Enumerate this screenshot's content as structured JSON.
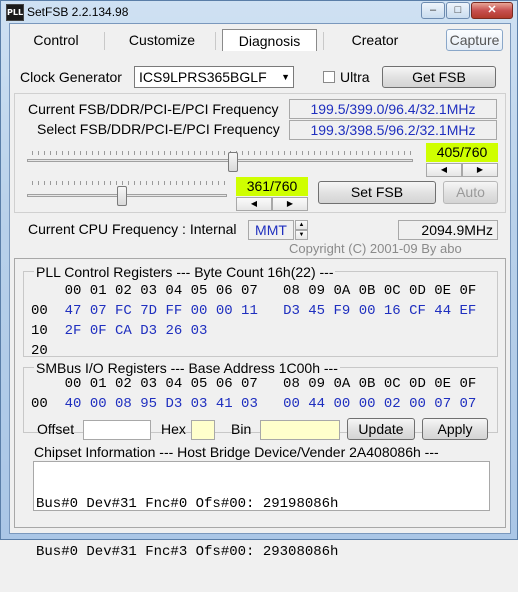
{
  "window": {
    "title": "SetFSB 2.2.134.98",
    "icon_text": "PLL",
    "controls": {
      "minimize": "–",
      "maximize": "□",
      "close": "✕"
    }
  },
  "tabs": [
    {
      "label": "Control"
    },
    {
      "label": "Customize"
    },
    {
      "label": "Diagnosis"
    },
    {
      "label": "Creator"
    },
    {
      "label": "Capture"
    }
  ],
  "clock": {
    "label": "Clock Generator",
    "value": "ICS9LPRS365BGLF",
    "ultra_label": "Ultra",
    "get_fsb": "Get FSB"
  },
  "freq": {
    "current_label": "Current FSB/DDR/PCI-E/PCI Frequency",
    "current_value": "199.5/399.0/96.4/32.1MHz",
    "select_label": "Select FSB/DDR/PCI-E/PCI Frequency",
    "select_value": "199.3/398.5/96.2/32.1MHz"
  },
  "slider1": {
    "readout": "405/760",
    "value": 405,
    "max": 760
  },
  "slider2": {
    "readout": "361/760",
    "value": 361,
    "max": 760
  },
  "actions": {
    "set_fsb": "Set FSB",
    "auto": "Auto"
  },
  "cpu": {
    "label": "Current CPU Frequency : Internal",
    "source": "MMT",
    "value": "2094.9MHz"
  },
  "copyright": "Copyright (C) 2001-09 By abo",
  "pll": {
    "header": "PLL Control Registers  --- Byte Count 16h(22) ---",
    "columns": "    00 01 02 03 04 05 06 07   08 09 0A 0B 0C 0D 0E 0F",
    "rows": [
      {
        "addr": "00",
        "a": "47 07 FC 7D FF 00 00 11",
        "b": "D3 45 F9 00 16 CF 44 EF"
      },
      {
        "addr": "10",
        "a": "2F 0F CA D3 26 03",
        "b": ""
      },
      {
        "addr": "20",
        "a": "",
        "b": ""
      }
    ]
  },
  "smbus": {
    "header": "SMBus I/O Registers  --- Base Address 1C00h ---",
    "columns": "    00 01 02 03 04 05 06 07   08 09 0A 0B 0C 0D 0E 0F",
    "rows": [
      {
        "addr": "00",
        "a": "40 00 08 95 D3 03 41 03",
        "b": "00 44 00 00 02 00 07 07"
      }
    ]
  },
  "edit": {
    "offset_label": "Offset",
    "hex_label": "Hex",
    "bin_label": "Bin",
    "update": "Update",
    "apply": "Apply"
  },
  "chipset": {
    "header": "Chipset Information  --- Host Bridge Device/Vender 2A408086h ---",
    "lines": [
      "Bus#0 Dev#31 Fnc#0 Ofs#00: 29198086h",
      "Bus#0 Dev#31 Fnc#3 Ofs#00: 29308086h"
    ]
  },
  "colors": {
    "accent_text": "#1f2fbf",
    "highlight": "#cfff00",
    "hex_input": "#ffffcc"
  }
}
